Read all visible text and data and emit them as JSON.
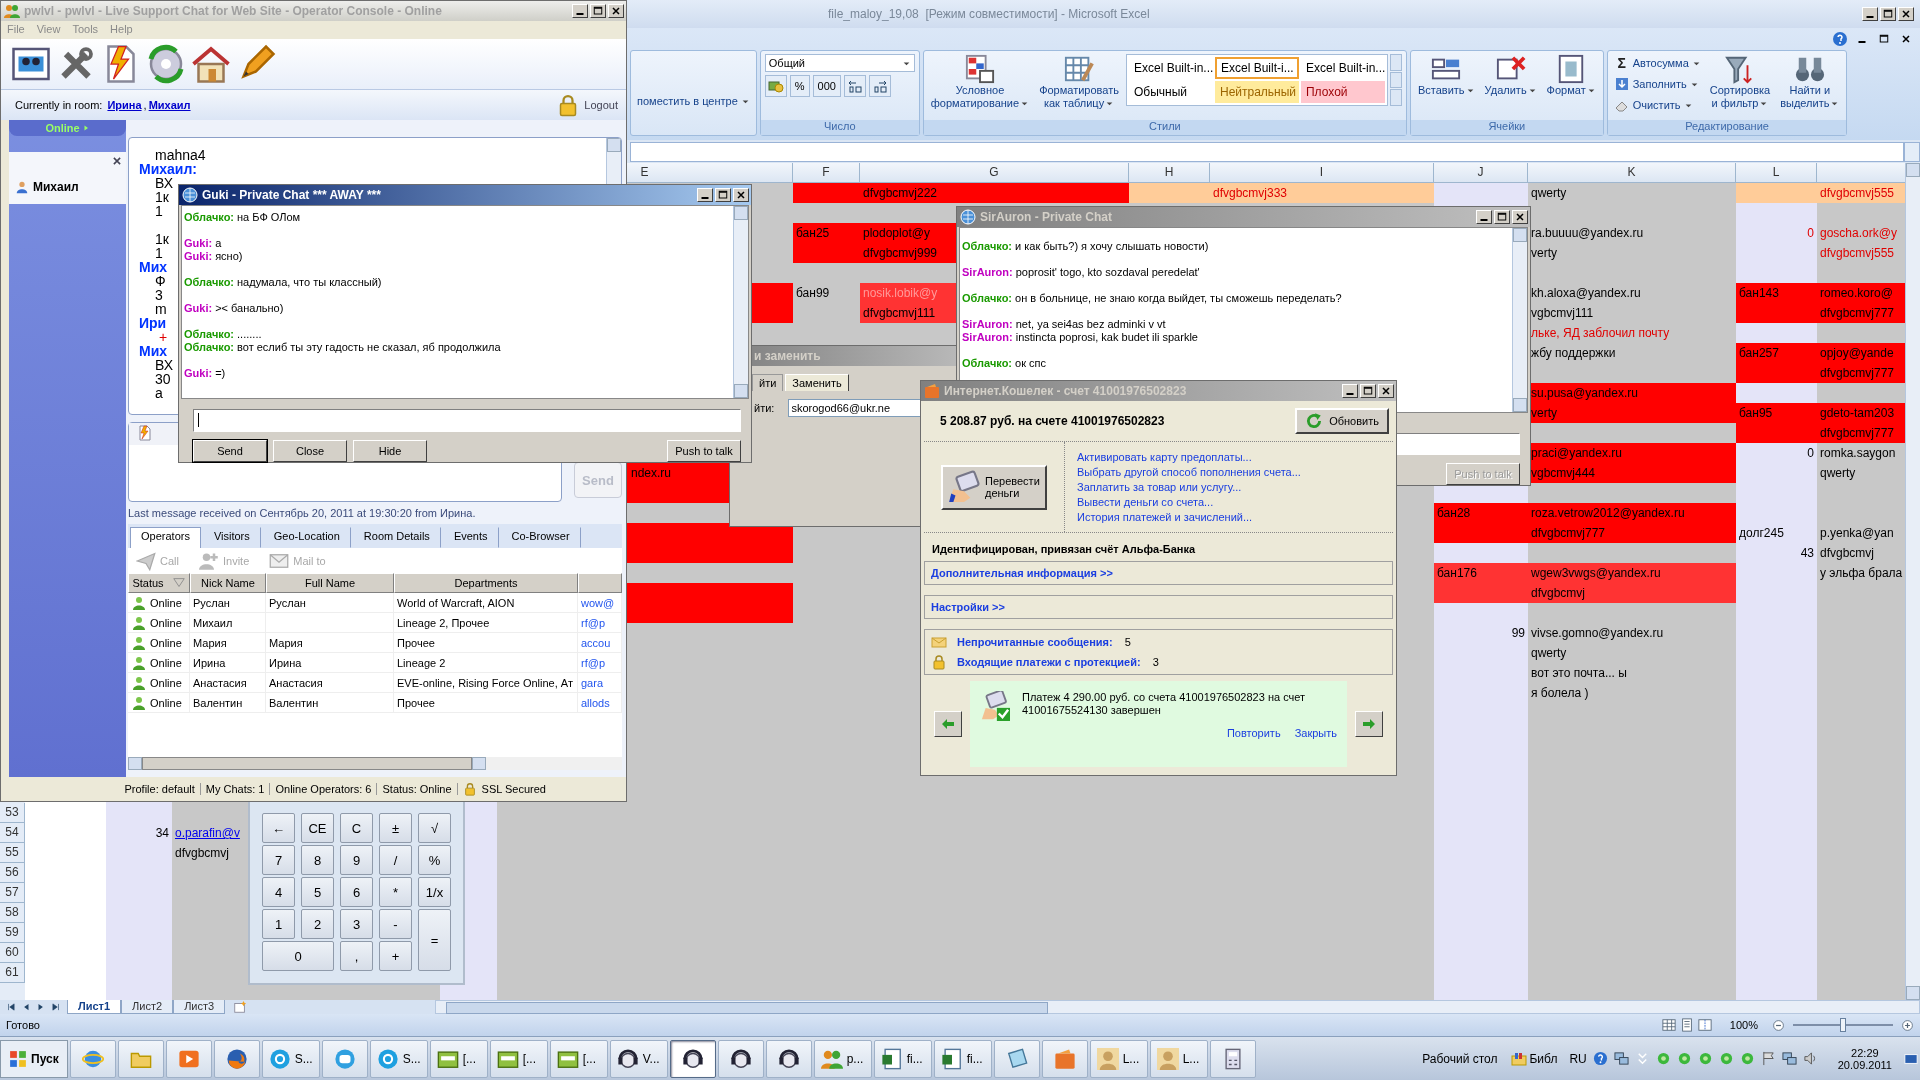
{
  "excel": {
    "title": "file_maloy_19,08  [Режим совместимости] - Microsoft Excel",
    "active": false,
    "ribbon": [
      {
        "kind": "align",
        "items": [
          {
            "kind": "small",
            "label": "поместить в центре",
            "menu": true
          }
        ]
      },
      {
        "label": "Число",
        "items": [
          {
            "kind": "stack",
            "items": [
              {
                "kind": "dropdown",
                "value": "Общий"
              },
              {
                "kind": "tools",
                "tools": [
                  {
                    "kind": "currency"
                  },
                  {
                    "label": "%"
                  },
                  {
                    "label": "000"
                  },
                  {
                    "kind": "decimal-more"
                  },
                  {
                    "kind": "decimal-less"
                  }
                ]
              }
            ]
          }
        ]
      },
      {
        "label": "Стили",
        "items": [
          {
            "kind": "large",
            "lines": [
              "Условное",
              "форматирование"
            ],
            "menu": true
          },
          {
            "kind": "large",
            "lines": [
              "Форматировать",
              "как таблицу"
            ],
            "menu": true
          },
          {
            "kind": "gallery",
            "styles": [
              {
                "label": "Excel Built-in...",
                "kind": "plain",
                "selected": false
              },
              {
                "label": "Excel Built-i...",
                "kind": "plain",
                "selected": true
              },
              {
                "label": "Excel Built-in...",
                "kind": "plain",
                "selected": false
              },
              {
                "label": "Обычный",
                "kind": "plain",
                "selected": false
              },
              {
                "label": "Нейтральный",
                "kind": "neutral",
                "selected": false
              },
              {
                "label": "Плохой",
                "kind": "bad",
                "selected": false
              }
            ]
          }
        ]
      },
      {
        "label": "Ячейки",
        "items": [
          {
            "kind": "large",
            "lines": [
              "Вставить"
            ],
            "menu": true
          },
          {
            "kind": "large",
            "lines": [
              "Удалить"
            ],
            "menu": true
          },
          {
            "kind": "large",
            "lines": [
              "Формат"
            ],
            "menu": true
          }
        ]
      },
      {
        "label": "Редактирование",
        "items": [
          {
            "kind": "stack",
            "items": [
              {
                "kind": "small",
                "glyph": "Σ",
                "label": "Автосумма",
                "menu": true
              },
              {
                "kind": "small",
                "label": "Заполнить",
                "menu": true
              },
              {
                "kind": "small",
                "label": "Очистить",
                "menu": true
              }
            ]
          },
          {
            "kind": "large",
            "lines": [
              "Сортировка",
              "и фильтр"
            ],
            "menu": true
          },
          {
            "kind": "large",
            "lines": [
              "Найти и",
              "выделить"
            ],
            "menu": true
          }
        ]
      }
    ],
    "columns": [
      {
        "color": "#ffffff"
      },
      {
        "color": "#e4e4f8"
      },
      {
        "color": "#c8c8c8"
      },
      {
        "color": "#e4e4f8"
      },
      {
        "header": "E",
        "color": "#c8c8c8"
      },
      {
        "header": "F",
        "color": "#c8c8c8"
      },
      {
        "header": "G",
        "color": "#c8c8c8"
      },
      {
        "header": "H",
        "color": "#c8c8c8"
      },
      {
        "header": "I",
        "color": "#c8c8c8"
      },
      {
        "header": "J",
        "color": "#e4e4f8"
      },
      {
        "header": "K",
        "color": "#c8c8c8"
      },
      {
        "header": "L",
        "color": "#e4e4f8"
      },
      {
        "color": "#c8c8c8"
      }
    ],
    "rows": [
      {
        "cells": [
          {},
          {},
          {},
          {},
          {},
          {
            "color": "#ff0000"
          },
          {
            "text": "dfvgbcmvj222",
            "color": "#ff0000",
            "kind": "text"
          },
          {
            "color": "#ffcc99"
          },
          {
            "text": "dfvgbcmvj333",
            "color": "#ffcc99",
            "kind": "warning"
          },
          {},
          {
            "text": "qwerty",
            "kind": "text"
          },
          {
            "color": "#ffcc99"
          },
          {
            "text": "dfvgbcmvj555",
            "color": "#ffcc99",
            "kind": "warning"
          }
        ]
      },
      {},
      {
        "cells": [
          {},
          {},
          {},
          {},
          {},
          {
            "text": "бан25",
            "color": "#ff0000",
            "kind": "text"
          },
          {
            "text": "plodoplot@y",
            "color": "#ff0000",
            "kind": "text"
          },
          {},
          {},
          {},
          {
            "text": "ra.buuuu@yandex.ru",
            "kind": "text"
          },
          {
            "text": "0",
            "kind": "number-warning"
          },
          {
            "text": "goscha.ork@y",
            "kind": "warning"
          }
        ]
      },
      {
        "cells": [
          {},
          {},
          {},
          {},
          {},
          {
            "color": "#ff0000"
          },
          {
            "text": "dfvgbcmvj999",
            "color": "#ff0000",
            "kind": "text"
          },
          {},
          {},
          {},
          {
            "text": "verty",
            "kind": "text"
          },
          {},
          {
            "text": "dfvgbcmvj555",
            "kind": "warning"
          }
        ]
      },
      {},
      {
        "cells": [
          {},
          {},
          {},
          {},
          {
            "color": "#ff0000"
          },
          {
            "text": "бан99",
            "kind": "text"
          },
          {
            "text": "nosik.lobik@y",
            "color": "#ff3333",
            "kind": "muted"
          },
          {},
          {},
          {},
          {
            "text": "kh.aloxa@yandex.ru",
            "kind": "text"
          },
          {
            "text": "бан143",
            "color": "#ff0000",
            "kind": "text"
          },
          {
            "text": "romeo.koro@",
            "color": "#ff0000",
            "kind": "text"
          }
        ]
      },
      {
        "cells": [
          {},
          {},
          {},
          {},
          {
            "color": "#ff0000"
          },
          {},
          {
            "text": "dfvgbcmvj111",
            "color": "#ff3333",
            "kind": "text"
          },
          {},
          {},
          {},
          {
            "text": "vgbcmvj111",
            "kind": "text"
          },
          {
            "color": "#ff0000"
          },
          {
            "text": "dfvgbcmvj777",
            "color": "#ff0000",
            "kind": "text"
          }
        ]
      },
      {
        "cells": [
          {},
          {},
          {},
          {},
          {},
          {},
          {},
          {},
          {},
          {},
          {
            "text": "льке, ЯД заблочил почту",
            "kind": "warning"
          }
        ]
      },
      {
        "cells": [
          {},
          {},
          {},
          {},
          {},
          {},
          {},
          {},
          {},
          {},
          {
            "text": "жбу поддержки",
            "kind": "text"
          },
          {
            "text": "бан257",
            "color": "#ff0000",
            "kind": "text"
          },
          {
            "text": "opjoy@yande",
            "color": "#ff0000",
            "kind": "text"
          }
        ]
      },
      {
        "cells": [
          {},
          {},
          {},
          {},
          {},
          {},
          {},
          {},
          {},
          {},
          {},
          {
            "color": "#ff0000"
          },
          {
            "text": "dfvgbcmvj777",
            "color": "#ff0000",
            "kind": "text"
          }
        ]
      },
      {
        "cells": [
          {},
          {},
          {},
          {},
          {},
          {},
          {},
          {},
          {},
          {},
          {
            "text": "su.pusa@yandex.ru",
            "color": "#ff0000",
            "kind": "text"
          }
        ]
      },
      {
        "cells": [
          {},
          {},
          {},
          {},
          {},
          {},
          {},
          {},
          {},
          {},
          {
            "text": "verty",
            "color": "#ff0000",
            "kind": "text"
          },
          {
            "text": "бан95",
            "color": "#ff0000",
            "kind": "text"
          },
          {
            "text": "gdeto-tam203",
            "color": "#ff0000",
            "kind": "text"
          }
        ]
      },
      {
        "cells": [
          {},
          {},
          {},
          {},
          {},
          {},
          {},
          {},
          {},
          {},
          {},
          {
            "color": "#ff0000"
          },
          {
            "text": "dfvgbcmvj777",
            "color": "#ff0000",
            "kind": "text"
          }
        ]
      },
      {
        "cells": [
          {},
          {},
          {},
          {},
          {},
          {},
          {},
          {},
          {},
          {},
          {
            "text": "praci@yandex.ru",
            "color": "#ff0000",
            "kind": "text"
          },
          {
            "text": "0",
            "kind": "number"
          },
          {
            "text": "romka.saygon",
            "kind": "text"
          }
        ]
      },
      {
        "cells": [
          {},
          {},
          {},
          {},
          {
            "text": "ndex.ru",
            "color": "#ff0000",
            "kind": "partial"
          },
          {},
          {},
          {},
          {},
          {},
          {
            "text": "vgbcmvj444",
            "color": "#ff0000",
            "kind": "text"
          },
          {},
          {
            "text": "qwerty",
            "kind": "text"
          }
        ]
      },
      {
        "cells": [
          {},
          {},
          {},
          {},
          {
            "color": "#ff0000"
          }
        ]
      },
      {
        "cells": [
          {},
          {},
          {},
          {},
          {},
          {},
          {},
          {},
          {},
          {
            "text": "бан28",
            "color": "#ff0000",
            "kind": "text"
          },
          {
            "text": "roza.vetrow2012@yandex.ru",
            "color": "#ff0000",
            "kind": "text"
          }
        ]
      },
      {
        "cells": [
          {},
          {},
          {},
          {},
          {
            "color": "#ff0000"
          },
          {},
          {},
          {},
          {},
          {
            "color": "#ff0000"
          },
          {
            "text": "dfvgbcmvj777",
            "color": "#ff0000",
            "kind": "text"
          },
          {
            "text": "долг245",
            "kind": "text"
          },
          {
            "text": "p.yenka@yan",
            "kind": "text"
          }
        ]
      },
      {
        "cells": [
          {},
          {},
          {},
          {},
          {
            "color": "#ff0000"
          },
          {},
          {},
          {},
          {},
          {},
          {},
          {
            "text": "43",
            "kind": "number"
          },
          {
            "text": "dfvgbcmvj",
            "kind": "text"
          }
        ]
      },
      {
        "cells": [
          {},
          {},
          {},
          {},
          {},
          {},
          {},
          {},
          {},
          {
            "text": "бан176",
            "color": "#ff3333",
            "kind": "text"
          },
          {
            "text": "wgew3vwgs@yandex.ru",
            "color": "#ff3333",
            "kind": "text"
          },
          {},
          {
            "text": "у эльфа брала",
            "kind": "text"
          }
        ]
      },
      {
        "cells": [
          {},
          {},
          {},
          {},
          {
            "color": "#ff0000"
          },
          {},
          {},
          {},
          {},
          {
            "color": "#ff3333"
          },
          {
            "text": "dfvgbcmvj",
            "color": "#ff3333",
            "kind": "text"
          }
        ]
      },
      {
        "cells": [
          {},
          {},
          {},
          {},
          {
            "color": "#ff0000"
          }
        ]
      },
      {
        "cells": [
          {},
          {},
          {},
          {},
          {},
          {},
          {},
          {},
          {},
          {
            "text": "99",
            "kind": "number"
          },
          {
            "text": "vivse.gomno@yandex.ru",
            "kind": "text"
          }
        ]
      },
      {
        "cells": [
          {},
          {},
          {},
          {},
          {},
          {},
          {},
          {},
          {},
          {},
          {
            "text": "qwerty",
            "kind": "text"
          }
        ]
      },
      {
        "cells": [
          {},
          {},
          {},
          {},
          {},
          {},
          {},
          {},
          {},
          {},
          {
            "text": "вот это почта... ы",
            "kind": "text"
          }
        ]
      },
      {
        "cells": [
          {},
          {},
          {},
          {},
          {},
          {},
          {},
          {},
          {},
          {},
          {
            "text": "я болела )",
            "kind": "text"
          }
        ]
      },
      {},
      {},
      {},
      {},
      {},
      {
        "number": "53"
      },
      {
        "number": "54",
        "cells": [
          {},
          {
            "text": "34",
            "kind": "number"
          },
          {
            "text": "o.parafin@v",
            "kind": "link"
          }
        ]
      },
      {
        "number": "55",
        "cells": [
          {},
          {},
          {
            "text": "dfvgbcmvj",
            "kind": "text"
          }
        ]
      },
      {
        "number": "56"
      },
      {
        "number": "57"
      },
      {
        "number": "58"
      },
      {
        "number": "59"
      },
      {
        "number": "60"
      },
      {
        "number": "61"
      }
    ],
    "sheets": [
      {
        "label": "Лист1",
        "selected": true
      },
      {
        "label": "Лист2",
        "selected": false
      },
      {
        "label": "Лист3",
        "selected": false
      }
    ],
    "status": "Готово",
    "zoom": "100%",
    "zoom_slider": {
      "level": 0.5
    }
  },
  "console": {
    "title": "pwlvl - pwlvl - Live Support Chat for Web Site - Operator Console - Online",
    "active": false,
    "menu": [
      "File",
      "View",
      "Tools",
      "Help"
    ],
    "room_label": "Currently in room:",
    "room_people": [
      "Ирина",
      "Михаил"
    ],
    "room_separator": ",",
    "logout": "Logout",
    "status_tab": "Online",
    "sessions": [
      {
        "name": "Михаил"
      }
    ],
    "transcript": [
      {
        "kind": "text",
        "text": "mahna4"
      },
      {
        "kind": "name",
        "text": "Михаил:"
      },
      {
        "kind": "text",
        "text": "ВХ"
      },
      {
        "kind": "text",
        "text": "1к"
      },
      {
        "kind": "text",
        "text": "1"
      },
      {
        "kind": "text",
        "text": "1к",
        "space_before": true
      },
      {
        "kind": "text",
        "text": "1"
      },
      {
        "kind": "name",
        "text": "Мих"
      },
      {
        "kind": "text",
        "text": "Ф"
      },
      {
        "kind": "text",
        "text": "3"
      },
      {
        "kind": "text",
        "text": "m"
      },
      {
        "kind": "name",
        "text": "Ири"
      },
      {
        "kind": "mark",
        "text": "+"
      },
      {
        "kind": "name",
        "text": "Мих"
      },
      {
        "kind": "text",
        "text": "ВХ"
      },
      {
        "kind": "text",
        "text": "30"
      },
      {
        "kind": "text",
        "text": "а"
      }
    ],
    "send": {
      "label": "Send",
      "disabled": true
    },
    "last_message": "Last message received on Сентябрь 20, 2011 at 19:30:20 from Ирина.",
    "tabs": [
      {
        "label": "Operators",
        "selected": true
      },
      {
        "label": "Visitors",
        "selected": false
      },
      {
        "label": "Geo-Location",
        "selected": false
      },
      {
        "label": "Room Details",
        "selected": false
      },
      {
        "label": "Events",
        "selected": false
      },
      {
        "label": "Co-Browser",
        "selected": false
      }
    ],
    "actions": [
      {
        "label": "Call",
        "disabled": true
      },
      {
        "label": "Invite",
        "disabled": true
      },
      {
        "label": "Mail to",
        "disabled": true
      }
    ],
    "table": {
      "columns": [
        "Status",
        "Nick Name",
        "Full Name",
        "Departments"
      ],
      "rows": [
        {
          "status": "Online",
          "nick": "Руслан",
          "full": "Руслан",
          "departments": "World of Warcraft, AION",
          "column_5": "wow@"
        },
        {
          "status": "Online",
          "nick": "Михаил",
          "departments": "Lineage 2, Прочее",
          "column_5": "rf@p"
        },
        {
          "status": "Online",
          "nick": "Мария",
          "full": "Мария",
          "departments": "Прочее",
          "column_5": "accou"
        },
        {
          "status": "Online",
          "nick": "Ирина",
          "full": "Ирина",
          "departments": "Lineage 2",
          "column_5": "rf@p"
        },
        {
          "status": "Online",
          "nick": "Анастасия",
          "full": "Анастасия",
          "departments": "EVE-online, Rising Force Online, Ат",
          "column_5": "gara"
        },
        {
          "status": "Online",
          "nick": "Валентин",
          "full": "Валентин",
          "departments": "Прочее",
          "column_5": "allods"
        }
      ]
    },
    "status_bar": [
      "Profile: default",
      "My Chats: 1",
      "Online Operators: 6",
      "Status: Online",
      "SSL Secured"
    ]
  },
  "calculator": {
    "keys": [
      {
        "label": "←"
      },
      {
        "label": "CE"
      },
      {
        "label": "C"
      },
      {
        "label": "±"
      },
      {
        "label": "√"
      },
      {
        "label": "7"
      },
      {
        "label": "8"
      },
      {
        "label": "9"
      },
      {
        "label": "/"
      },
      {
        "label": "%"
      },
      {
        "label": "4"
      },
      {
        "label": "5"
      },
      {
        "label": "6"
      },
      {
        "label": "*"
      },
      {
        "label": "1/x"
      },
      {
        "label": "1"
      },
      {
        "label": "2"
      },
      {
        "label": "3"
      },
      {
        "label": "-"
      },
      {
        "label": "=",
        "kind": "tall"
      },
      {
        "label": "0",
        "kind": "wide"
      },
      {
        "label": ","
      },
      {
        "label": "+"
      }
    ]
  },
  "guki_chat": {
    "title": "Guki - Private Chat *** AWAY ***",
    "active": true,
    "messages": [
      [
        {
          "speaker": "Облачко:",
          "kind": "self",
          "text": "на БФ ОЛом"
        }
      ],
      [
        {
          "speaker": "Guki:",
          "kind": "peer",
          "text": "а"
        },
        {
          "speaker": "Guki:",
          "kind": "peer",
          "text": "ясно)"
        }
      ],
      [
        {
          "speaker": "Облачко:",
          "kind": "self",
          "text": "надумала, что ты классный)"
        }
      ],
      [
        {
          "speaker": "Guki:",
          "kind": "peer",
          "text": "><  банально)"
        }
      ],
      [
        {
          "speaker": "Облачко:",
          "kind": "self",
          "text": "........"
        },
        {
          "speaker": "Облачко:",
          "kind": "self",
          "text": "вот еслиб ты эту гадость не сказал, яб продолжила"
        }
      ],
      [
        {
          "speaker": "Guki:",
          "kind": "peer",
          "text": "=)"
        }
      ]
    ],
    "buttons": [
      {
        "label": "Send",
        "default": true
      },
      {
        "label": "Close",
        "default": false
      },
      {
        "label": "Hide",
        "default": false
      },
      {
        "label": "Push to talk",
        "default": false
      }
    ]
  },
  "find_dialog": {
    "title": "и заменить",
    "active": false,
    "tabs": [
      {
        "label": "йти",
        "selected": false
      },
      {
        "label": "Заменить",
        "selected": true
      }
    ],
    "field_label": "йти:",
    "field_value": "skorogod66@ukr.ne"
  },
  "sirauron_chat": {
    "title": "SirAuron - Private Chat",
    "active": false,
    "messages": [
      [
        {
          "speaker": "Облачко:",
          "kind": "self",
          "text": "и как быть?) я хочу слышать новости)"
        }
      ],
      [
        {
          "speaker": "SirAuron:",
          "kind": "peer",
          "text": "poprosit' togo, kto sozdaval peredelat'"
        }
      ],
      [
        {
          "speaker": "Облачко:",
          "kind": "self",
          "text": "он в больнице, не знаю когда выйдет, ты сможешь переделать?"
        }
      ],
      [
        {
          "speaker": "SirAuron:",
          "kind": "peer",
          "text": "net, ya sei4as bez adminki v vt"
        },
        {
          "speaker": "SirAuron:",
          "kind": "peer",
          "text": "instincta poprosi, kak budet ili sparkle"
        }
      ],
      [
        {
          "speaker": "Облачко:",
          "kind": "self",
          "text": "ок спс"
        }
      ]
    ],
    "push_to_talk": {
      "label": "Push to talk",
      "disabled": true
    }
  },
  "wallet": {
    "title": "Интернет.Кошелек - счет 41001976502823",
    "active": false,
    "balance": "5 208.87 руб. на счете  41001976502823",
    "refresh": "Обновить",
    "transfer": "Перевести деньги",
    "links": [
      "Активировать карту предоплаты...",
      "Выбрать другой способ пополнения счета...",
      "Заплатить за товар или услугу...",
      "Вывести деньги со счета...",
      "История платежей и зачислений..."
    ],
    "identified": "Идентифицирован, привязан счёт Альфа-Банка",
    "expanders": [
      "Дополнительная информация >>",
      "Настройки >>"
    ],
    "counters": [
      {
        "kind": "mail",
        "label": "Непрочитанные сообщения:",
        "value": "5"
      },
      {
        "kind": "lock",
        "label": "Входящие платежи с протекцией:",
        "value": "3"
      }
    ],
    "notice": {
      "text": "Платеж 4 290.00 руб. со счета 41001976502823 на счет 41001675524130 завершен",
      "actions": [
        "Повторить",
        "Закрыть"
      ]
    }
  },
  "taskbar": {
    "start": "Пуск",
    "items": [
      {
        "kind": "ie",
        "selected": false
      },
      {
        "kind": "folder",
        "selected": false
      },
      {
        "kind": "media",
        "selected": false
      },
      {
        "kind": "firefox",
        "selected": false
      },
      {
        "kind": "skype",
        "label": "S...",
        "selected": false
      },
      {
        "kind": "chat",
        "selected": false
      },
      {
        "kind": "skype",
        "label": "S...",
        "selected": false
      },
      {
        "kind": "green",
        "label": "[...",
        "selected": false
      },
      {
        "kind": "green",
        "label": "[...",
        "selected": false
      },
      {
        "kind": "green",
        "label": "[...",
        "selected": false
      },
      {
        "kind": "headset",
        "label": "V...",
        "selected": false
      },
      {
        "kind": "headset",
        "selected": true
      },
      {
        "kind": "headset",
        "selected": false
      },
      {
        "kind": "headset",
        "selected": false
      },
      {
        "kind": "people",
        "label": "p...",
        "selected": false
      },
      {
        "kind": "excel",
        "label": "fi...",
        "selected": false
      },
      {
        "kind": "excel",
        "label": "fi...",
        "selected": false
      },
      {
        "kind": "notepad",
        "selected": false
      },
      {
        "kind": "wallet",
        "selected": false
      },
      {
        "kind": "avatar",
        "label": "L...",
        "selected": false
      },
      {
        "kind": "avatar",
        "label": "L...",
        "selected": false
      },
      {
        "kind": "calc",
        "selected": false
      }
    ],
    "desktop": "Рабочий стол",
    "library": "Библ",
    "lang": "RU",
    "time": "22:29",
    "date": "20.09.2011"
  }
}
